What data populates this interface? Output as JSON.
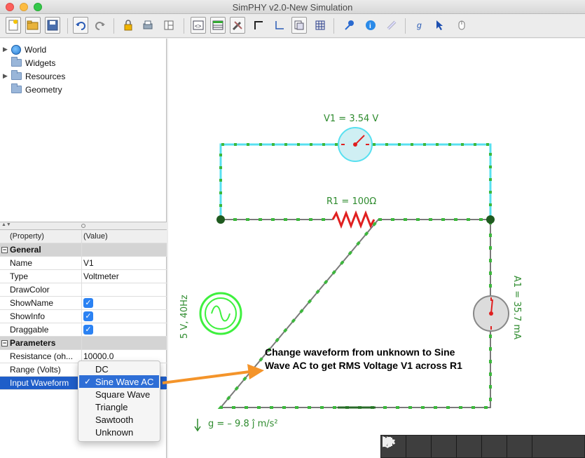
{
  "window": {
    "title": "SimPHY v2.0-New Simulation"
  },
  "toolbar": {
    "icons": [
      "new-file-icon",
      "open-folder-icon",
      "save-icon",
      "undo-icon",
      "redo-icon",
      "lock-icon",
      "print-icon",
      "layout-icon",
      "code-view-icon",
      "table-view-icon",
      "tools-icon",
      "corner-icon",
      "axis-icon",
      "copy-icon",
      "grid-icon",
      "pin-icon",
      "info-icon",
      "link-icon",
      "gravity-icon",
      "move-icon",
      "mouse-icon"
    ]
  },
  "tree": {
    "items": [
      {
        "label": "World",
        "icon": "globe-icon",
        "expandable": true
      },
      {
        "label": "Widgets",
        "icon": "folder-icon",
        "expandable": false
      },
      {
        "label": "Resources",
        "icon": "folder-icon",
        "expandable": true
      },
      {
        "label": "Geometry",
        "icon": "folder-icon",
        "expandable": false
      }
    ]
  },
  "properties": {
    "header_property": "(Property)",
    "header_value": "(Value)",
    "groups": {
      "general": "General",
      "parameters": "Parameters"
    },
    "rows": {
      "name": {
        "label": "Name",
        "value": "V1"
      },
      "type": {
        "label": "Type",
        "value": "Voltmeter"
      },
      "drawcolor": {
        "label": "DrawColor",
        "value": ""
      },
      "showname": {
        "label": "ShowName",
        "value": "✓"
      },
      "showinfo": {
        "label": "ShowInfo",
        "value": "✓"
      },
      "draggable": {
        "label": "Draggable",
        "value": "✓"
      },
      "resistance": {
        "label": "Resistance (oh...",
        "value": "10000.0"
      },
      "range": {
        "label": "Range (Volts)",
        "value": ""
      },
      "waveform": {
        "label": "Input Waveform",
        "value": ""
      }
    }
  },
  "dropdown": {
    "options": [
      "DC",
      "Sine Wave AC",
      "Square Wave",
      "Triangle",
      "Sawtooth",
      "Unknown"
    ],
    "selected": "Sine Wave AC",
    "check": "✓"
  },
  "circuit": {
    "voltmeter_label": "V1 = 3.54 V",
    "resistor_label": "R1 = 100Ω",
    "source_label": "5 V, 40Hz",
    "ammeter_label": "A1 = 35.7 mA",
    "gravity_label": "g = – 9.8 ĵ m/s²",
    "colors": {
      "wire_cyan": "#58e0f0",
      "wire_green": "#3cb83c",
      "resistor": "#e02020",
      "source": "#3ef03e"
    }
  },
  "annotation": {
    "text": "Change waveform from unknown to Sine Wave AC to get RMS Voltage V1 across R1",
    "arrow_color": "#f4942a"
  },
  "sim_controls": {
    "buttons": [
      "pointer-icon",
      "reset-icon",
      "undo-step-icon",
      "pause-icon",
      "redo-step-icon",
      "step-forward-icon",
      "pen-icon"
    ]
  }
}
